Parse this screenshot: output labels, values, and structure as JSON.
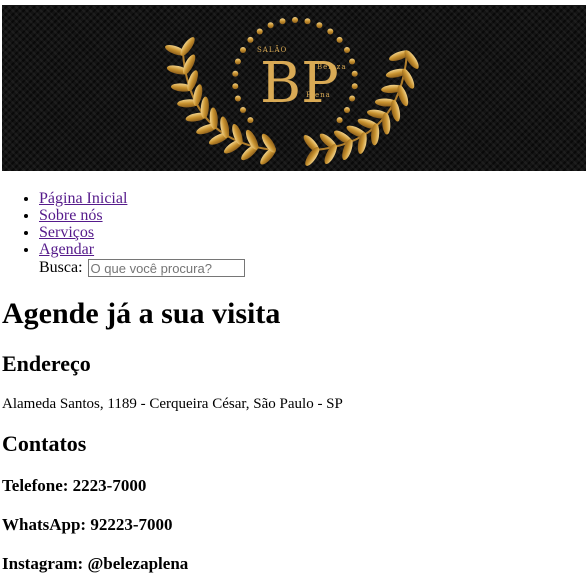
{
  "banner": {
    "logo_letters": "BP",
    "logo_top_text": "SALÃO",
    "logo_side_text": "Beleza",
    "logo_bottom_text": "Plena",
    "gold": "#d9aa55",
    "background": "#141414"
  },
  "nav": {
    "items": [
      {
        "label": "Página Inicial"
      },
      {
        "label": "Sobre nós"
      },
      {
        "label": "Serviços"
      },
      {
        "label": "Agendar"
      }
    ],
    "link_color": "#551a8b"
  },
  "search": {
    "label": "Busca:",
    "placeholder": "O que você procura?",
    "value": ""
  },
  "main": {
    "title": "Agende já a sua visita",
    "address_heading": "Endereço",
    "address": "Alameda Santos, 1189 - Cerqueira César, São Paulo - SP",
    "contacts_heading": "Contatos",
    "phone": "Telefone: 2223-7000",
    "whatsapp": "WhatsApp: 92223-7000",
    "instagram": "Instagram: @belezaplena"
  }
}
